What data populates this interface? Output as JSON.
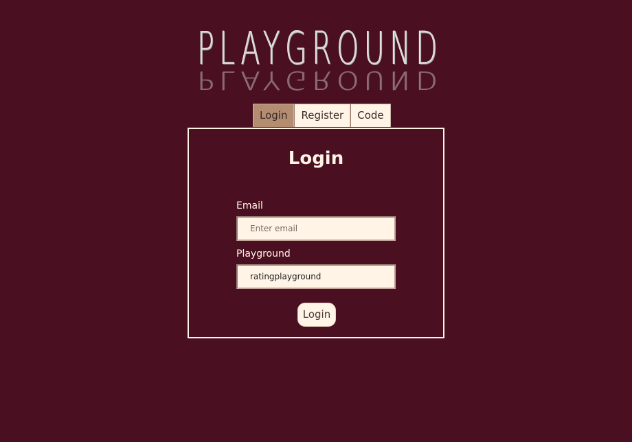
{
  "logo": {
    "text": "PLAYGROUND"
  },
  "tabs": [
    {
      "label": "Login",
      "active": true
    },
    {
      "label": "Register",
      "active": false
    },
    {
      "label": "Code",
      "active": false
    }
  ],
  "panel": {
    "title": "Login",
    "email": {
      "label": "Email",
      "placeholder": "Enter email",
      "value": ""
    },
    "playground": {
      "label": "Playground",
      "value": "ratingplayground"
    },
    "submit_label": "Login"
  },
  "colors": {
    "background": "#4a0f20",
    "panel_border": "#fff4e6",
    "tab_active": "#b48c70",
    "tab_inactive": "#fff4e6",
    "input_background": "#fff4e6"
  }
}
